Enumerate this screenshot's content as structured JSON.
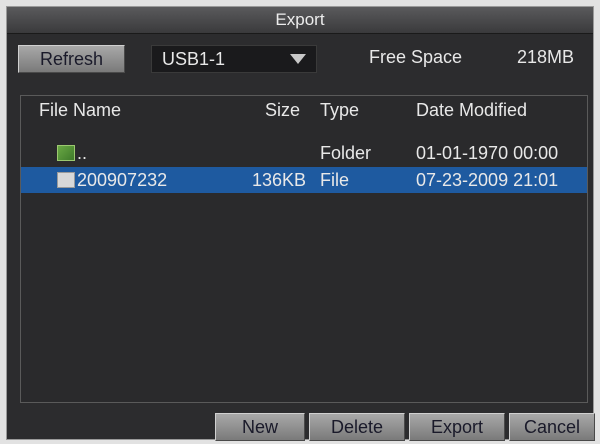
{
  "window": {
    "title": "Export"
  },
  "toolbar": {
    "refresh_label": "Refresh",
    "device": "USB1-1",
    "free_space_label": "Free Space",
    "free_space_value": "218MB"
  },
  "file_list": {
    "columns": {
      "name": "File Name",
      "size": "Size",
      "type": "Type",
      "date": "Date Modified"
    },
    "rows": [
      {
        "name": "..",
        "size": "",
        "type": "Folder",
        "date": "01-01-1970 00:00",
        "icon": "folder-icon"
      },
      {
        "name": "200907232",
        "size": "136KB",
        "type": "File",
        "date": "07-23-2009 21:01",
        "icon": "file-icon",
        "selected": true
      }
    ]
  },
  "actions": {
    "new_label": "New",
    "delete_label": "Delete",
    "export_label": "Export",
    "cancel_label": "Cancel"
  },
  "colors": {
    "selection": "#1e5aa0",
    "background": "#2c2c2e"
  }
}
